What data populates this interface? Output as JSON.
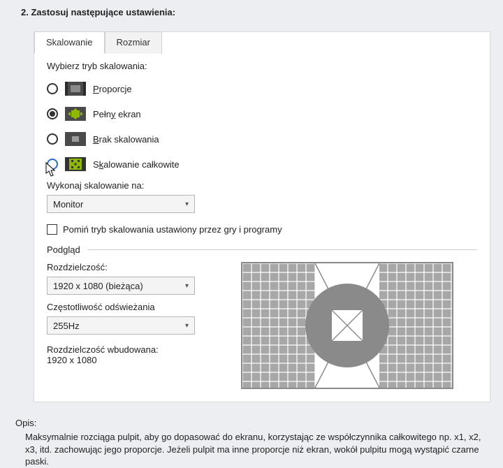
{
  "section_title": "2. Zastosuj następujące ustawienia:",
  "tabs": {
    "scaling": "Skalowanie",
    "size": "Rozmiar"
  },
  "choose_mode_label": "Wybierz tryb skalowania:",
  "modes": {
    "aspect": {
      "label": "Proporcje",
      "hotkey": "P"
    },
    "fullscreen": {
      "label": "Pełny ekran",
      "hotkey": "y"
    },
    "no_scaling": {
      "label": "Brak skalowania",
      "hotkey": "B"
    },
    "integer": {
      "label": "Skalowanie całkowite",
      "hotkey": "k"
    }
  },
  "selected_mode": "fullscreen",
  "hovered_mode": "integer",
  "perform_on_label": "Wykonaj skalowanie na:",
  "perform_on_value": "Monitor",
  "override_label": "Pomiń tryb skalowania ustawiony przez gry i programy",
  "override_checked": false,
  "preview_heading": "Podgląd",
  "resolution_label": "Rozdzielczość:",
  "resolution_value": "1920 x 1080 (bieżąca)",
  "refresh_label": "Częstotliwość odświeżania",
  "refresh_value": "255Hz",
  "native_res_label": "Rozdzielczość wbudowana:",
  "native_res_value": "1920 x 1080",
  "description_heading": "Opis:",
  "description_body": "Maksymalnie rozciąga pulpit, aby go dopasować do ekranu, korzystając ze współczynnika całkowitego np. x1, x2, x3, itd. zachowując jego proporcje. Jeżeli pulpit ma inne proporcje niż ekran, wokół pulpitu mogą wystąpić czarne paski.",
  "colors": {
    "icon_dark": "#4a4a4a",
    "icon_accent": "#8fb900"
  }
}
